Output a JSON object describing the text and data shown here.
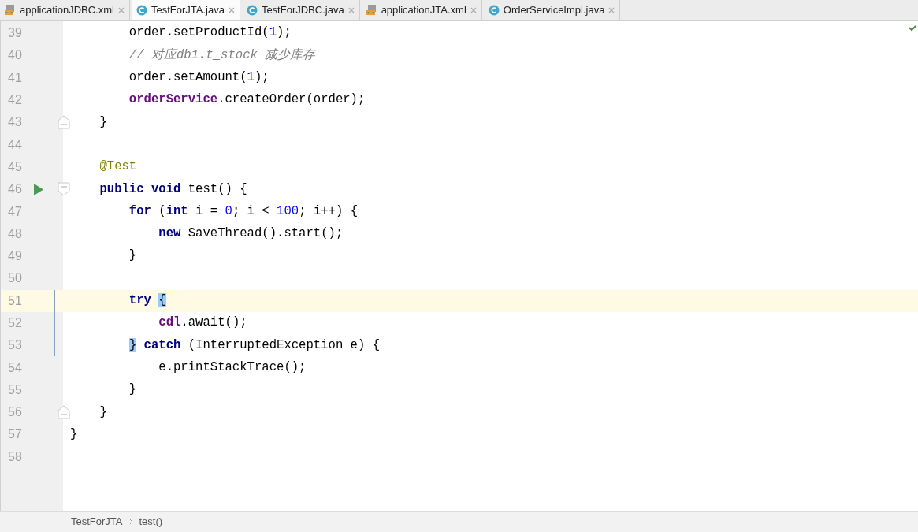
{
  "tabs": [
    {
      "label": "applicationJDBC.xml",
      "kind": "xml",
      "selected": false
    },
    {
      "label": "TestForJTA.java",
      "kind": "java",
      "selected": true
    },
    {
      "label": "TestForJDBC.java",
      "kind": "java",
      "selected": false
    },
    {
      "label": "applicationJTA.xml",
      "kind": "xml",
      "selected": false
    },
    {
      "label": "OrderServiceImpl.java",
      "kind": "java",
      "selected": false
    }
  ],
  "lines": [
    {
      "number": "39",
      "current": false,
      "changed": false,
      "run": false,
      "tokens": [
        {
          "kind": "plain",
          "text": "        order.setProductId("
        },
        {
          "kind": "num",
          "text": "1"
        },
        {
          "kind": "plain",
          "text": ");"
        }
      ]
    },
    {
      "number": "40",
      "current": false,
      "changed": false,
      "run": false,
      "tokens": [
        {
          "kind": "comment",
          "text": "        // 对应db1.t_stock 减少库存"
        }
      ]
    },
    {
      "number": "41",
      "current": false,
      "changed": false,
      "run": false,
      "tokens": [
        {
          "kind": "plain",
          "text": "        order.setAmount("
        },
        {
          "kind": "num",
          "text": "1"
        },
        {
          "kind": "plain",
          "text": ");"
        }
      ]
    },
    {
      "number": "42",
      "current": false,
      "changed": false,
      "run": false,
      "tokens": [
        {
          "kind": "field",
          "text": "        orderService"
        },
        {
          "kind": "plain",
          "text": ".createOrder(order);"
        }
      ]
    },
    {
      "number": "43",
      "current": false,
      "changed": false,
      "run": false,
      "fold_end": true,
      "tokens": [
        {
          "kind": "plain",
          "text": "    }"
        }
      ]
    },
    {
      "number": "44",
      "current": false,
      "changed": false,
      "run": false
    },
    {
      "number": "45",
      "current": false,
      "changed": false,
      "run": false,
      "tokens": [
        {
          "kind": "annotation",
          "text": "    @Test"
        }
      ]
    },
    {
      "number": "46",
      "current": false,
      "changed": false,
      "run": true,
      "fold_start": true,
      "tokens": [
        {
          "kind": "kw",
          "text": "    public void "
        },
        {
          "kind": "plain",
          "text": "test() {"
        }
      ]
    },
    {
      "number": "47",
      "current": false,
      "changed": false,
      "run": false,
      "tokens": [
        {
          "kind": "kw",
          "text": "        for "
        },
        {
          "kind": "plain",
          "text": "("
        },
        {
          "kind": "kw",
          "text": "int "
        },
        {
          "kind": "plain",
          "text": "i = "
        },
        {
          "kind": "num",
          "text": "0"
        },
        {
          "kind": "plain",
          "text": "; i < "
        },
        {
          "kind": "num",
          "text": "100"
        },
        {
          "kind": "plain",
          "text": "; i++) {"
        }
      ]
    },
    {
      "number": "48",
      "current": false,
      "changed": false,
      "run": false,
      "tokens": [
        {
          "kind": "kw",
          "text": "            new "
        },
        {
          "kind": "plain",
          "text": "SaveThread().start();"
        }
      ]
    },
    {
      "number": "49",
      "current": false,
      "changed": false,
      "run": false,
      "tokens": [
        {
          "kind": "plain",
          "text": "        }"
        }
      ]
    },
    {
      "number": "50",
      "current": false,
      "changed": false,
      "run": false
    },
    {
      "number": "51",
      "current": true,
      "changed": true,
      "run": false,
      "tokens": [
        {
          "kind": "kw",
          "text": "        try "
        },
        {
          "kind": "match",
          "text": "{"
        }
      ]
    },
    {
      "number": "52",
      "current": false,
      "changed": true,
      "run": false,
      "tokens": [
        {
          "kind": "field",
          "text": "            cdl"
        },
        {
          "kind": "plain",
          "text": ".await();"
        }
      ]
    },
    {
      "number": "53",
      "current": false,
      "changed": true,
      "run": false,
      "tokens": [
        {
          "kind": "match",
          "text": "        }"
        },
        {
          "kind": "kw",
          "text": " catch "
        },
        {
          "kind": "plain",
          "text": "(InterruptedException e) {"
        }
      ]
    },
    {
      "number": "54",
      "current": false,
      "changed": false,
      "run": false,
      "tokens": [
        {
          "kind": "plain",
          "text": "            e.printStackTrace();"
        }
      ]
    },
    {
      "number": "55",
      "current": false,
      "changed": false,
      "run": false,
      "tokens": [
        {
          "kind": "plain",
          "text": "        }"
        }
      ]
    },
    {
      "number": "56",
      "current": false,
      "changed": false,
      "run": false,
      "fold_end": true,
      "tokens": [
        {
          "kind": "plain",
          "text": "    }"
        }
      ]
    },
    {
      "number": "57",
      "current": false,
      "changed": false,
      "run": false,
      "tokens": [
        {
          "kind": "plain",
          "text": "}"
        }
      ]
    },
    {
      "number": "58",
      "current": false,
      "changed": false,
      "run": false
    }
  ],
  "breadcrumbs": [
    "TestForJTA",
    "test()"
  ]
}
